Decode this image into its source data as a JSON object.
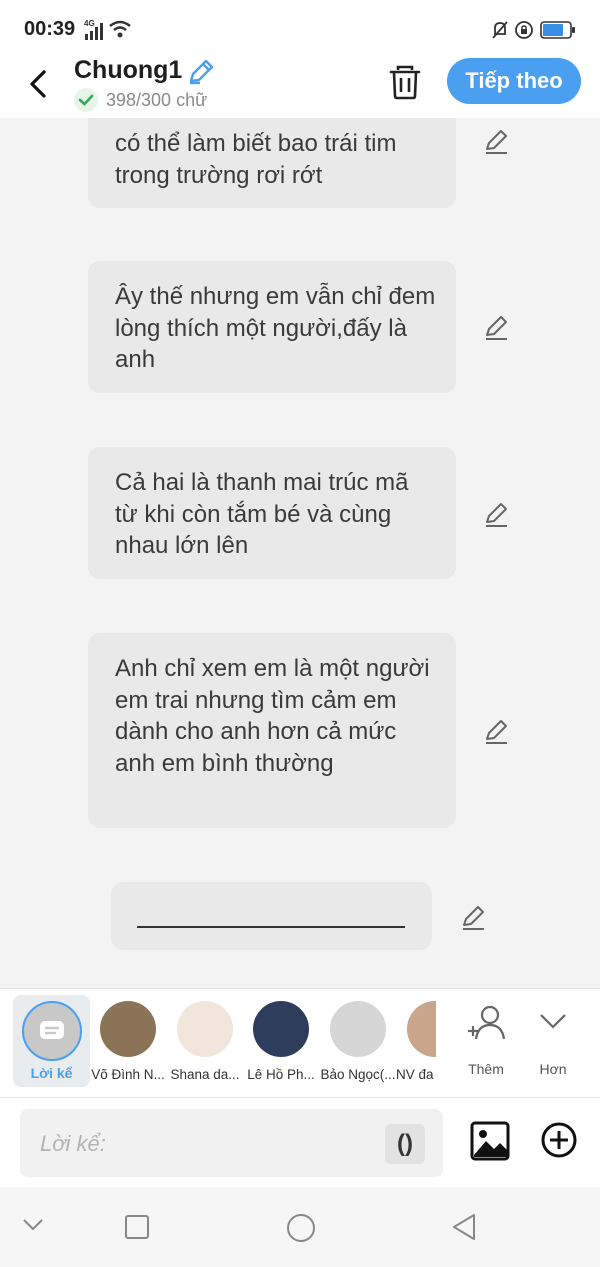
{
  "status_bar": {
    "time": "00:39",
    "network": "4G",
    "icons": [
      "signal-icon",
      "wifi-icon",
      "mute-bell-icon",
      "rotation-lock-icon",
      "battery-icon"
    ]
  },
  "header": {
    "title": "Chuong1",
    "word_count": "398/300 chữ",
    "next_label": "Tiếp theo",
    "accent_color": "#4a9ff0"
  },
  "messages": [
    {
      "text": "có thể làm biết bao trái tim trong trường rơi rớt"
    },
    {
      "text": "Ây thế nhưng em vẫn chỉ đem lòng thích một người,đấy là anh"
    },
    {
      "text": "Cả hai là thanh mai trúc mã từ khi còn tắm bé và cùng nhau lớn lên"
    },
    {
      "text": "Anh chỉ xem em là một người em trai nhưng tìm cảm em dành cho anh hơn cả mức anh em bình thường"
    }
  ],
  "blank_message": "",
  "narrators": {
    "selected": "Lời kể",
    "cast": [
      {
        "name": "Võ Đình N...",
        "avatar_color": "#8b7358"
      },
      {
        "name": "Shana da...",
        "avatar_color": "#f1e6dc"
      },
      {
        "name": "Lê Hồ Ph...",
        "avatar_color": "#2f3d5c"
      },
      {
        "name": "Bảo Ngọc(...",
        "avatar_color": "#d6d6d6"
      },
      {
        "name": "NV đa",
        "avatar_color": "#c9a58c"
      }
    ],
    "add_label": "Thêm",
    "more_label": "Hơn"
  },
  "input": {
    "placeholder": "Lời kể:",
    "paren_label": "()"
  }
}
